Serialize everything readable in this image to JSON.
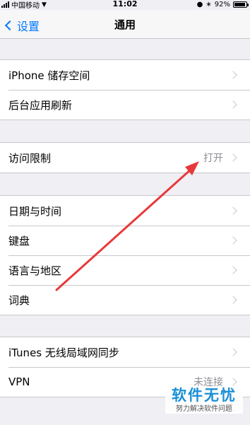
{
  "status_bar": {
    "carrier": "中国移动",
    "time": "11:02",
    "battery_percent": "92%",
    "battery_level": 0.92
  },
  "nav": {
    "back_label": "设置",
    "title": "通用"
  },
  "groups": [
    {
      "items": [
        {
          "label": "iPhone 储存空间"
        },
        {
          "label": "后台应用刷新"
        }
      ]
    },
    {
      "items": [
        {
          "label": "访问限制",
          "value": "打开"
        }
      ]
    },
    {
      "items": [
        {
          "label": "日期与时间"
        },
        {
          "label": "键盘"
        },
        {
          "label": "语言与地区"
        },
        {
          "label": "词典"
        }
      ]
    },
    {
      "items": [
        {
          "label": "iTunes 无线局域网同步"
        },
        {
          "label": "VPN",
          "value": "未连接"
        }
      ]
    }
  ],
  "annotation": {
    "arrow_color": "#e8383a"
  },
  "watermark": {
    "title": "软件无忧",
    "subtitle": "努力解决软件问题"
  }
}
